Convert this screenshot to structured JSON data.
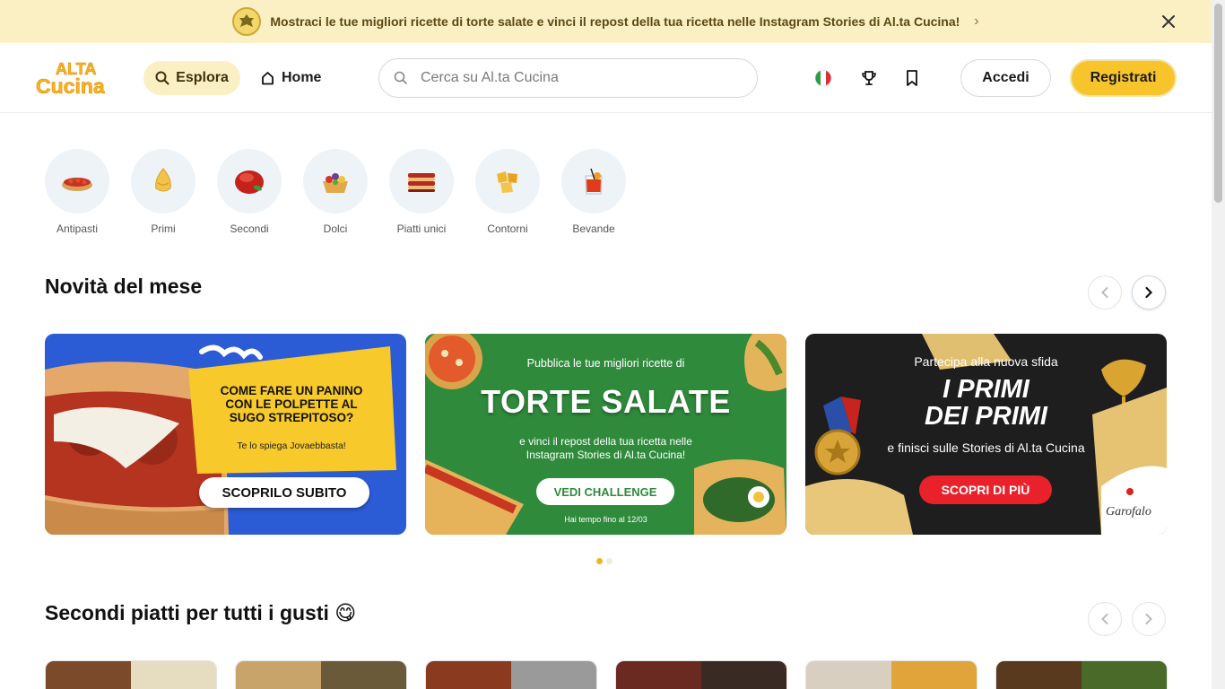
{
  "announcement": {
    "text": "Mostraci le tue migliori ricette di torte salate e vinci il repost della tua ricetta nelle Instagram Stories di Al.ta Cucina!",
    "chevron": "›"
  },
  "header": {
    "logo_line1": "ALTA",
    "logo_line2": "Cucina",
    "explore_label": "Esplora",
    "home_label": "Home",
    "search_placeholder": "Cerca su Al.ta Cucina",
    "login_label": "Accedi",
    "signup_label": "Registrati"
  },
  "categories": [
    {
      "label": "Antipasti",
      "icon": "bruschetta-icon"
    },
    {
      "label": "Primi",
      "icon": "pasta-icon"
    },
    {
      "label": "Secondi",
      "icon": "meat-icon"
    },
    {
      "label": "Dolci",
      "icon": "tart-icon"
    },
    {
      "label": "Piatti unici",
      "icon": "lasagna-icon"
    },
    {
      "label": "Contorni",
      "icon": "potatoes-icon"
    },
    {
      "label": "Bevande",
      "icon": "cocktail-icon"
    }
  ],
  "sections": {
    "news_title": "Novità del mese",
    "second_title": "Secondi piatti per tutti i gusti 😋"
  },
  "banners": [
    {
      "headline": "COME FARE UN PANINO CON LE POLPETTE AL SUGO STREPITOSO?",
      "sub": "Te lo spiega Jovaebbasta!",
      "cta": "SCOPRILO SUBITO"
    },
    {
      "pre": "Pubblica le tue migliori ricette di",
      "headline": "TORTE SALATE",
      "sub": "e vinci il repost della tua ricetta nelle Instagram Stories di Al.ta Cucina!",
      "cta": "VEDI CHALLENGE",
      "note": "Hai tempo fino al 12/03"
    },
    {
      "pre": "Partecipa alla nuova sfida",
      "headline1": "I PRIMI",
      "headline2": "DEI PRIMI",
      "sub": "e finisci sulle Stories di Al.ta Cucina",
      "cta": "SCOPRI DI PIÙ",
      "brand": "Garofalo"
    }
  ],
  "colors": {
    "accent": "#f7c52b",
    "announce_bg": "#fbefc4",
    "banner_blue": "#2c5bd6",
    "banner_green": "#2f8a3c",
    "banner_dark": "#1e1e1e",
    "cta_red": "#e8212b"
  }
}
